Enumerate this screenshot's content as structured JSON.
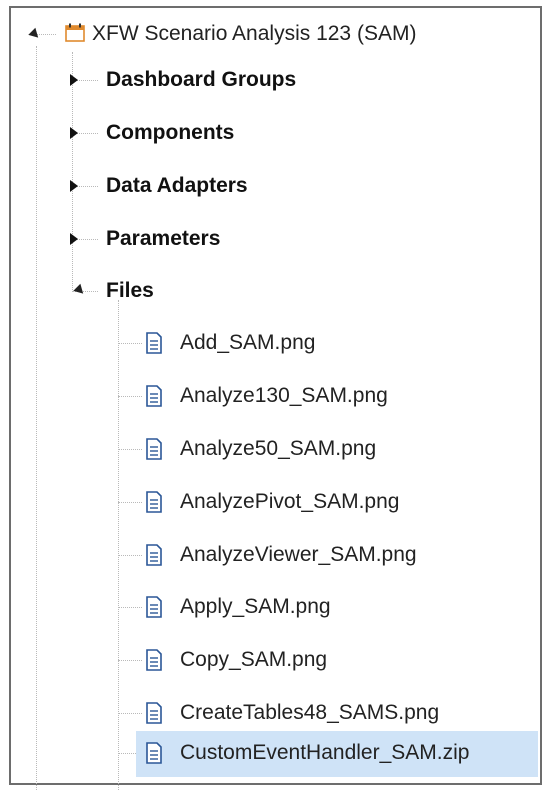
{
  "tree": {
    "root": {
      "label": "XFW Scenario Analysis 123 (SAM)",
      "icon": "folder-icon",
      "expanded": true
    },
    "groups": [
      {
        "label": "Dashboard Groups",
        "expanded": false
      },
      {
        "label": "Components",
        "expanded": false
      },
      {
        "label": "Data Adapters",
        "expanded": false
      },
      {
        "label": "Parameters",
        "expanded": false
      },
      {
        "label": "Files",
        "expanded": true
      }
    ],
    "files": [
      {
        "label": "Add_SAM.png",
        "icon": "document-icon"
      },
      {
        "label": "Analyze130_SAM.png",
        "icon": "document-icon"
      },
      {
        "label": "Analyze50_SAM.png",
        "icon": "document-icon"
      },
      {
        "label": "AnalyzePivot_SAM.png",
        "icon": "document-icon"
      },
      {
        "label": "AnalyzeViewer_SAM.png",
        "icon": "document-icon"
      },
      {
        "label": "Apply_SAM.png",
        "icon": "document-icon"
      },
      {
        "label": "Copy_SAM.png",
        "icon": "document-icon"
      },
      {
        "label": "CreateTables48_SAMS.png",
        "icon": "document-icon"
      },
      {
        "label": "CustomEventHandler_SAM.zip",
        "icon": "document-icon",
        "selected": true
      }
    ]
  },
  "colors": {
    "selection": "#cfe3f7",
    "folder_accent": "#e08a2e",
    "document_icon": "#2b5797"
  }
}
